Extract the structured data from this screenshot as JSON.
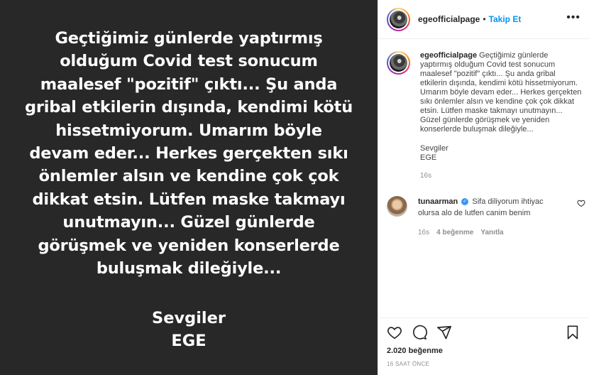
{
  "media": {
    "lines": [
      "Geçtiğimiz günlerde yaptırmış",
      "olduğum Covid test sonucum",
      "maalesef \"pozitif\" çıktı... Şu anda",
      "gribal etkilerin dışında, kendimi kötü",
      "hissetmiyorum. Umarım böyle",
      "devam eder... Herkes gerçekten sıkı",
      "önlemler alsın ve kendine çok çok",
      "dikkat etsin. Lütfen maske takmayı",
      "unutmayın... Güzel günlerde",
      "görüşmek ve yeniden konserlerde",
      "buluşmak dileğiyle..."
    ],
    "sign_line1": "Sevgiler",
    "sign_line2": "EGE"
  },
  "header": {
    "username": "egeofficialpage",
    "dot": "•",
    "follow_label": "Takip Et",
    "more_icon": "more-horizontal-icon"
  },
  "caption": {
    "username": "egeofficialpage",
    "text": "Geçtiğimiz günlerde yaptırmış olduğum Covid test sonucum maalesef \"pozitif\" çıktı... Şu anda gribal etkilerin dışında, kendimi kötü hissetmiyorum. Umarım böyle devam eder... Herkes gerçekten sıkı önlemler alsın ve kendine çok çok dikkat etsin. Lütfen maske takmayı unutmayın... Güzel günlerde görüşmek ve yeniden konserlerde buluşmak dileğiyle...",
    "sign_line1": "Sevgiler",
    "sign_line2": "EGE",
    "time": "16s"
  },
  "comment": {
    "username": "tunaarman",
    "text": "Sifa diliyorum ihtiyac olursa alo de lutfen canim benim",
    "time": "16s",
    "likes": "4 beğenme",
    "reply": "Yanıtla"
  },
  "actions": {
    "likes": "2.020 beğenme",
    "timestamp": "16 SAAT ÖNCE"
  },
  "colors": {
    "media_bg": "#282828",
    "accent": "#0095f6",
    "muted": "#8e8e8e"
  }
}
